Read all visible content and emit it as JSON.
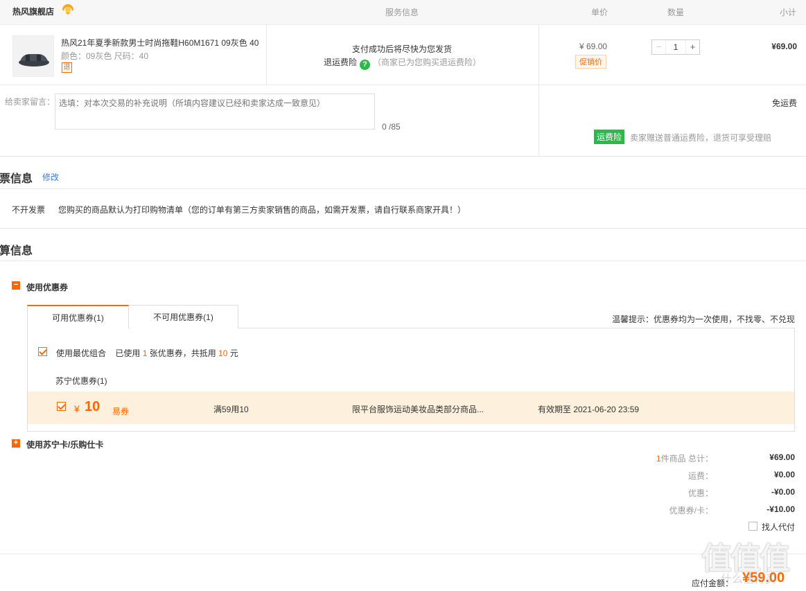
{
  "header": {
    "shop_name": "热风旗舰店",
    "col_service": "服务信息",
    "col_price": "单价",
    "col_qty": "数量",
    "col_subtotal": "小计"
  },
  "product": {
    "title": "热风21年夏季新款男士时尚拖鞋H60M1671 09灰色 40",
    "attrs": "颜色：09灰色    尺码：40",
    "return_tag": "退",
    "service_line1": "支付成功后将尽快为您发货",
    "service_insurance": "退运费险",
    "service_help_icon": "?",
    "service_note": "（商家已为您购买退运费险）",
    "price": "¥ 69.00",
    "promo_tag": "促销价",
    "qty_minus": "−",
    "quantity": "1",
    "qty_plus": "+",
    "subtotal": "¥69.00"
  },
  "message": {
    "label": "给卖家留言：",
    "placeholder": "选填：对本次交易的补充说明（所填内容建议已经和卖家达成一致意见）",
    "count": "0 /85",
    "shipping": "免运费",
    "insurance_badge": "运费险",
    "insurance_text": "卖家赠送普通运费险，退货可享受理赔"
  },
  "invoice": {
    "title": "发票信息",
    "edit": "修改",
    "type": "不开发票",
    "desc": "您购买的商品默认为打印购物清单（您的订单有第三方卖家销售的商品，如需开发票，请自行联系商家开具！）"
  },
  "settlement": {
    "title": "结算信息",
    "coupon_section": "使用优惠券",
    "coupon_toggle": "−",
    "card_section": "使用苏宁卡/乐购仕卡",
    "card_toggle": "+",
    "tabs": [
      {
        "label": "可用优惠券(1)"
      },
      {
        "label": "不可用优惠券(1)"
      }
    ],
    "tip": "温馨提示：优惠券均为一次使用，不找零、不兑现",
    "best_combo_label": "使用最优组合",
    "best_used_prefix": "已使用",
    "best_used_count": "1",
    "best_used_mid": "张优惠券，共抵用",
    "best_used_amount": "10",
    "best_used_suffix": "元",
    "group_name": "苏宁优惠券(1)",
    "coupon": {
      "currency": "¥",
      "amount": "10",
      "type": "易券",
      "condition": "满59用10",
      "scope": "限平台服饰运动美妆品类部分商品...",
      "validity": "有效期至 2021-06-20 23:59"
    }
  },
  "summary": {
    "item_count": "1",
    "items_label": "件商品 总计：",
    "items_total": "¥69.00",
    "shipping_label": "运费：",
    "shipping_value": "¥0.00",
    "discount_label": "优惠：",
    "discount_value": "-¥0.00",
    "coupon_label": "优惠券/卡：",
    "coupon_value": "-¥10.00",
    "pay_for_me": "找人代付",
    "payable_label": "应付金额：",
    "payable_value": "¥59.00"
  },
  "watermark": {
    "text": "值值值",
    "sub": "什么值得买"
  },
  "colors": {
    "accent": "#ff6600",
    "green": "#2db84a",
    "link": "#3a7bd5",
    "coupon_bg": "#fdf0dc"
  }
}
